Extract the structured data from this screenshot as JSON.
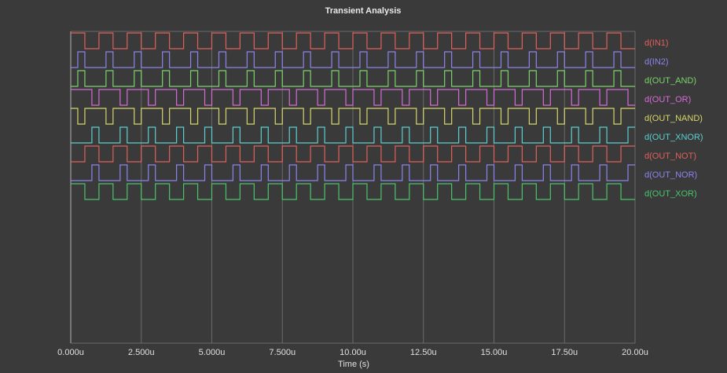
{
  "chart_data": {
    "type": "line",
    "title": "Transient Analysis",
    "xlabel": "Time (s)",
    "ylabel": "",
    "xlim": [
      0,
      20
    ],
    "x_unit_suffix": "u",
    "x_ticks": [
      "0.000u",
      "2.500u",
      "5.000u",
      "7.500u",
      "10.00u",
      "12.50u",
      "15.00u",
      "17.50u",
      "20.00u"
    ],
    "grid": true,
    "legend_placement": "right",
    "series": [
      {
        "name": "d(IN1)",
        "color": "#e0605a",
        "period": 1.0,
        "duty": 0.5,
        "phase": 0.0,
        "invert": false
      },
      {
        "name": "d(IN2)",
        "color": "#8c84ee",
        "period": 1.0,
        "duty": 0.25,
        "phase": 0.25,
        "invert": false
      },
      {
        "name": "d(OUT_AND)",
        "color": "#7ad36a",
        "period": 1.0,
        "duty": 0.25,
        "phase": 0.25,
        "invert": false
      },
      {
        "name": "d(OUT_OR)",
        "color": "#d86ad8",
        "period": 1.0,
        "duty": 0.75,
        "phase": 0.0,
        "invert": false
      },
      {
        "name": "d(OUT_NAND)",
        "color": "#d6d66a",
        "period": 1.0,
        "duty": 0.25,
        "phase": 0.25,
        "invert": true
      },
      {
        "name": "d(OUT_XNOR)",
        "color": "#5ad0d0",
        "period": 1.0,
        "duty": 0.25,
        "phase": 0.75,
        "invert": false
      },
      {
        "name": "d(OUT_NOT)",
        "color": "#e0605a",
        "period": 1.0,
        "duty": 0.5,
        "phase": 0.0,
        "invert": true
      },
      {
        "name": "d(OUT_NOR)",
        "color": "#8c84ee",
        "period": 1.0,
        "duty": 0.25,
        "phase": 0.75,
        "invert": false
      },
      {
        "name": "d(OUT_XOR)",
        "color": "#4ac46a",
        "period": 1.0,
        "duty": 0.5,
        "phase": 0.0,
        "invert": false
      }
    ]
  }
}
